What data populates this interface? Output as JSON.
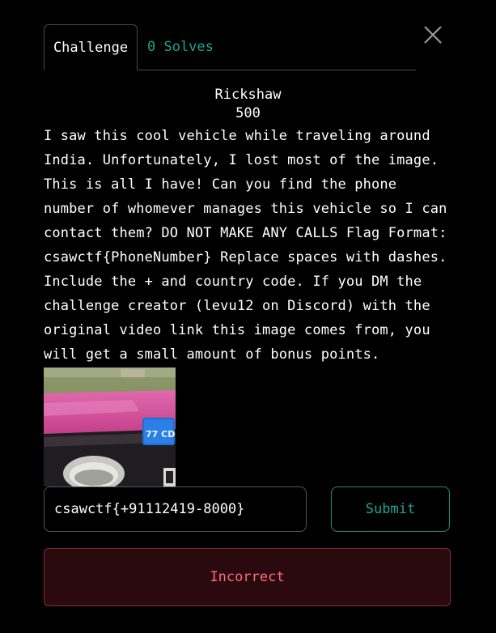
{
  "tabs": {
    "challenge_label": "Challenge",
    "solves_label": "0 Solves"
  },
  "challenge": {
    "name": "Rickshaw",
    "points": "500",
    "description": "I saw this cool vehicle while traveling around India. Unfortunately, I lost most of the image. This is all I have! Can you find the phone number of whomever manages this vehicle so I can contact them? DO NOT MAKE ANY CALLS Flag Format: csawctf{PhoneNumber} Replace spaces with dashes. Include the + and country code. If you DM the challenge creator (levu12 on Discord) with the original video link this image comes from, you will get a small amount of bonus points.",
    "plate_text": "77 CD"
  },
  "form": {
    "flag_value": "csawctf{+91112419-8000}",
    "submit_label": "Submit"
  },
  "result": {
    "message": "Incorrect"
  },
  "colors": {
    "background": "#000000",
    "accent": "#1aa68f",
    "error_text": "#ff6b7a",
    "error_bg": "#2a0a0f",
    "vehicle_pink": "#d94fa0",
    "plate_blue": "#1e6fd0"
  },
  "icons": {
    "close": "close-icon"
  }
}
